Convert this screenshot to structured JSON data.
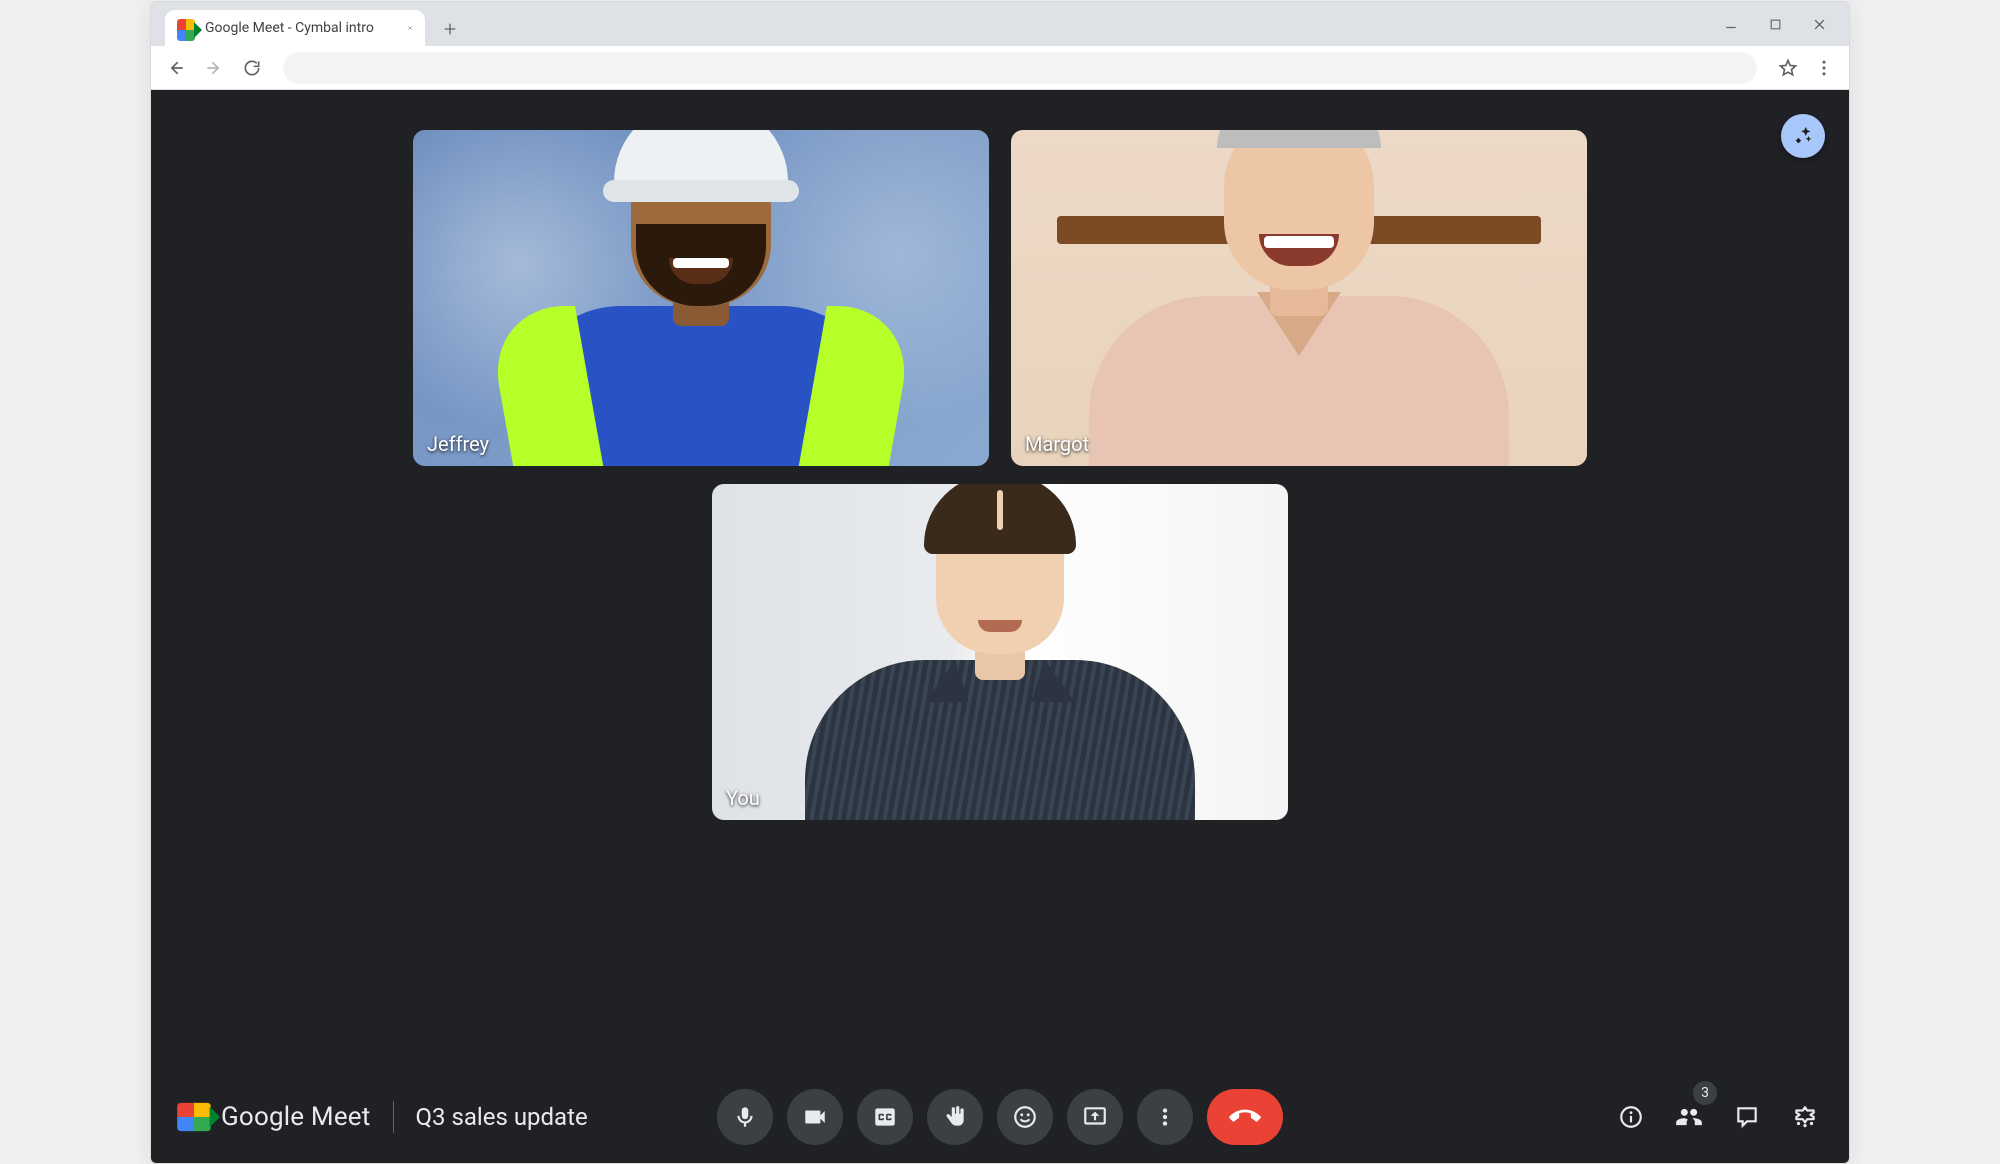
{
  "browser": {
    "tab_title": "Google Meet - Cymbal intro"
  },
  "meet": {
    "brand": "Google Meet",
    "meeting_name": "Q3 sales update",
    "participants_badge": "3"
  },
  "tiles": [
    {
      "name": "Jeffrey"
    },
    {
      "name": "Margot"
    },
    {
      "name": "You"
    }
  ]
}
